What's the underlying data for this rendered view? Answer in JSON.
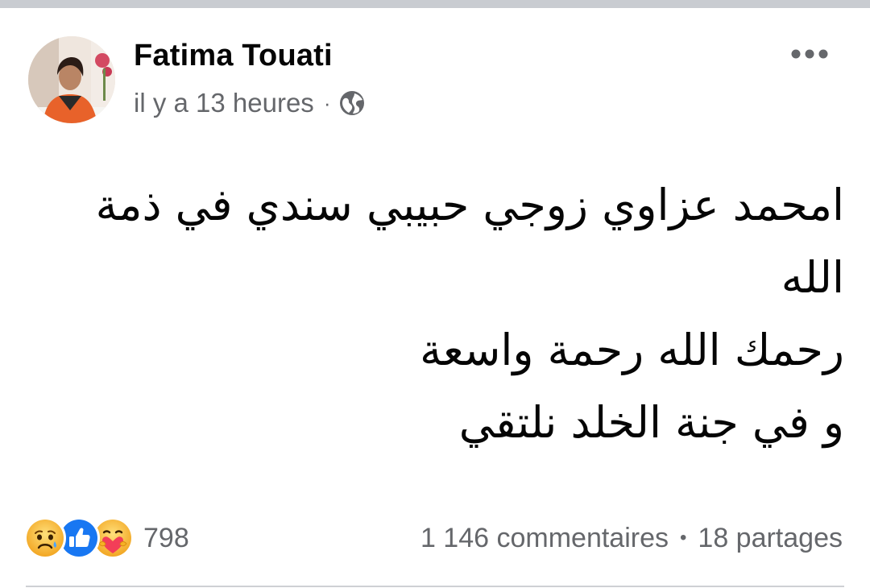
{
  "post": {
    "author": "Fatima Touati",
    "timestamp": "il y a 13 heures",
    "separator": "·",
    "audience_icon": "globe-icon",
    "more_icon": "more-horizontal-icon",
    "body_lines": [
      "امحمد عزاوي زوجي حبيبي سندي في ذمة الله",
      "رحمك الله رحمة واسعة",
      "و في جنة الخلد نلتقي"
    ]
  },
  "footer": {
    "reaction_icons": [
      "sad-reaction-icon",
      "like-reaction-icon",
      "care-reaction-icon"
    ],
    "reaction_count": "798",
    "comments": "1 146 commentaires",
    "separator": "•",
    "shares": "18 partages"
  },
  "colors": {
    "text_primary": "#050505",
    "text_secondary": "#65676b",
    "like_blue": "#1877f2",
    "reaction_yellow": "#f7b125",
    "care_pink": "#f33e58",
    "divider": "#ced0d4",
    "top_strip": "#c9ccd1"
  }
}
